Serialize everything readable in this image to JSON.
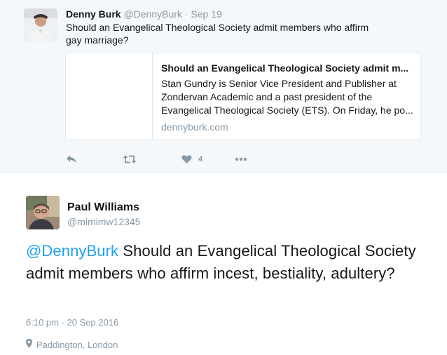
{
  "parent_tweet": {
    "author_name": "Denny Burk",
    "author_handle": "@DennyBurk",
    "separator": " · ",
    "date": "Sep 19",
    "text": "Should an Evangelical Theological Society admit members who affirm gay marriage?",
    "avatar_icon": "user-photo",
    "card": {
      "title": "Should an Evangelical Theological Society admit m...",
      "description": "Stan Gundry is Senior Vice President and Publisher at Zondervan Academic and a past president of the Evangelical Theological Society (ETS). On Friday, he po...",
      "domain": "dennyburk.com"
    },
    "actions": {
      "reply_icon": "reply-icon",
      "retweet_icon": "retweet-icon",
      "like_icon": "heart-icon",
      "like_count": "4",
      "more_icon": "more-icon"
    }
  },
  "main_tweet": {
    "author_name": "Paul Williams",
    "author_handle": "@mimimw12345",
    "mention": "@DennyBurk",
    "text": " Should an Evangelical Theological Society admit members who affirm incest, bestiality, adultery?",
    "timestamp": "6:10 pm - 20 Sep 2016",
    "location": "Paddington, London",
    "location_icon": "map-pin-icon"
  },
  "colors": {
    "link_blue": "#1da1f2",
    "muted_gray": "#8899a6",
    "parent_bg": "#f5f8fa",
    "border": "#e1e8ed"
  }
}
